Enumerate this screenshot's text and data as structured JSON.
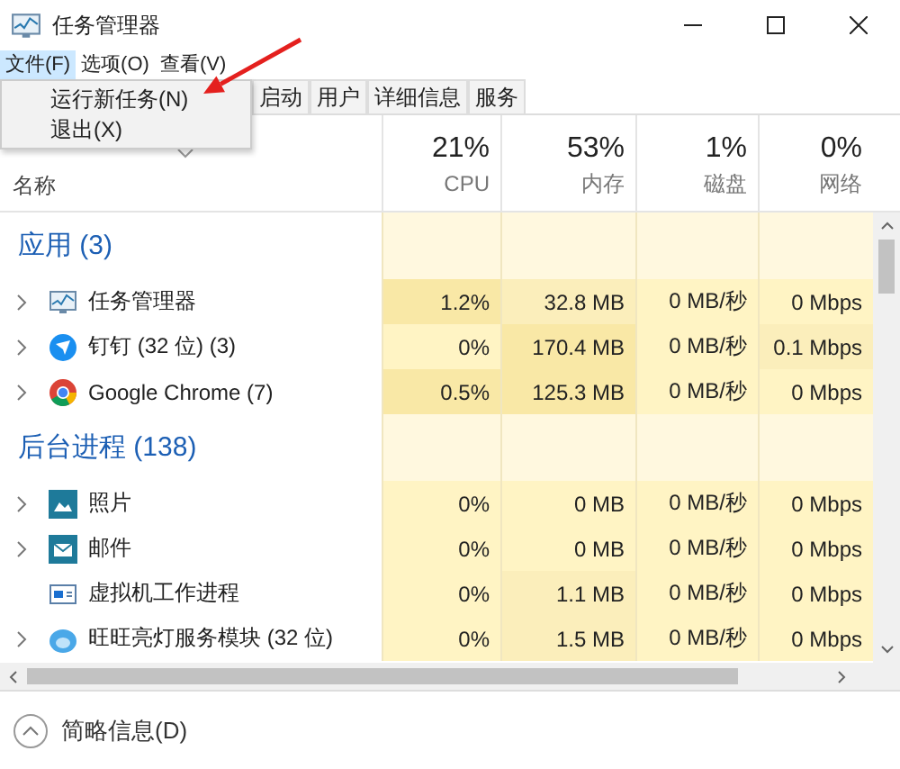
{
  "window": {
    "title": "任务管理器"
  },
  "menu": [
    {
      "label": "文件(F)",
      "selected": true
    },
    {
      "label": "选项(O)",
      "selected": false
    },
    {
      "label": "查看(V)",
      "selected": false
    }
  ],
  "dropdown": [
    "运行新任务(N)",
    "退出(X)"
  ],
  "tabs": [
    {
      "label": "启动",
      "selected": false
    },
    {
      "label": "用户",
      "selected": false
    },
    {
      "label": "详细信息",
      "selected": false
    },
    {
      "label": "服务",
      "selected": false
    }
  ],
  "name_column": "名称",
  "columns": [
    {
      "percent": "21%",
      "label": "CPU"
    },
    {
      "percent": "53%",
      "label": "内存"
    },
    {
      "percent": "1%",
      "label": "磁盘"
    },
    {
      "percent": "0%",
      "label": "网络"
    }
  ],
  "groups": [
    {
      "title": "应用 (3)",
      "rows": [
        {
          "name": "任务管理器",
          "kind": "monitor",
          "expandable": true,
          "cells": [
            {
              "text": "1.2%",
              "color": "#f9e8a6"
            },
            {
              "text": "32.8 MB",
              "color": "#fbeebb"
            },
            {
              "text": "0 MB/秒",
              "color": "#fff4c4"
            },
            {
              "text": "0 Mbps",
              "color": "#fff4c4"
            }
          ]
        },
        {
          "name": "钉钉 (32 位) (3)",
          "kind": "plane",
          "expandable": true,
          "cells": [
            {
              "text": "0%",
              "color": "#fff4c4"
            },
            {
              "text": "170.4 MB",
              "color": "#f9e8a6"
            },
            {
              "text": "0 MB/秒",
              "color": "#fff4c4"
            },
            {
              "text": "0.1 Mbps",
              "color": "#fbeebb"
            }
          ]
        },
        {
          "name": "Google Chrome (7)",
          "kind": "chrome",
          "expandable": true,
          "cells": [
            {
              "text": "0.5%",
              "color": "#f9e8a6"
            },
            {
              "text": "125.3 MB",
              "color": "#f9e8a6"
            },
            {
              "text": "0 MB/秒",
              "color": "#fff4c4"
            },
            {
              "text": "0 Mbps",
              "color": "#fff4c4"
            }
          ]
        }
      ]
    },
    {
      "title": "后台进程 (138)",
      "rows": [
        {
          "name": "照片",
          "kind": "photo",
          "expandable": true,
          "cells": [
            {
              "text": "0%",
              "color": "#fff4c4"
            },
            {
              "text": "0 MB",
              "color": "#fff4c4"
            },
            {
              "text": "0 MB/秒",
              "color": "#fff4c4"
            },
            {
              "text": "0 Mbps",
              "color": "#fff4c4"
            }
          ]
        },
        {
          "name": "邮件",
          "kind": "mail",
          "expandable": true,
          "cells": [
            {
              "text": "0%",
              "color": "#fff4c4"
            },
            {
              "text": "0 MB",
              "color": "#fff4c4"
            },
            {
              "text": "0 MB/秒",
              "color": "#fff4c4"
            },
            {
              "text": "0 Mbps",
              "color": "#fff4c4"
            }
          ]
        },
        {
          "name": "虚拟机工作进程",
          "kind": "window",
          "expandable": false,
          "cells": [
            {
              "text": "0%",
              "color": "#fff4c4"
            },
            {
              "text": "1.1 MB",
              "color": "#fbeebb"
            },
            {
              "text": "0 MB/秒",
              "color": "#fff4c4"
            },
            {
              "text": "0 Mbps",
              "color": "#fff4c4"
            }
          ]
        },
        {
          "name": "旺旺亮灯服务模块 (32 位)",
          "kind": "blob",
          "expandable": true,
          "cells": [
            {
              "text": "0%",
              "color": "#fff4c4"
            },
            {
              "text": "1.5 MB",
              "color": "#fbeebb"
            },
            {
              "text": "0 MB/秒",
              "color": "#fff4c4"
            },
            {
              "text": "0 Mbps",
              "color": "#fff4c4"
            }
          ]
        }
      ]
    }
  ],
  "footer": "简略信息(D)"
}
